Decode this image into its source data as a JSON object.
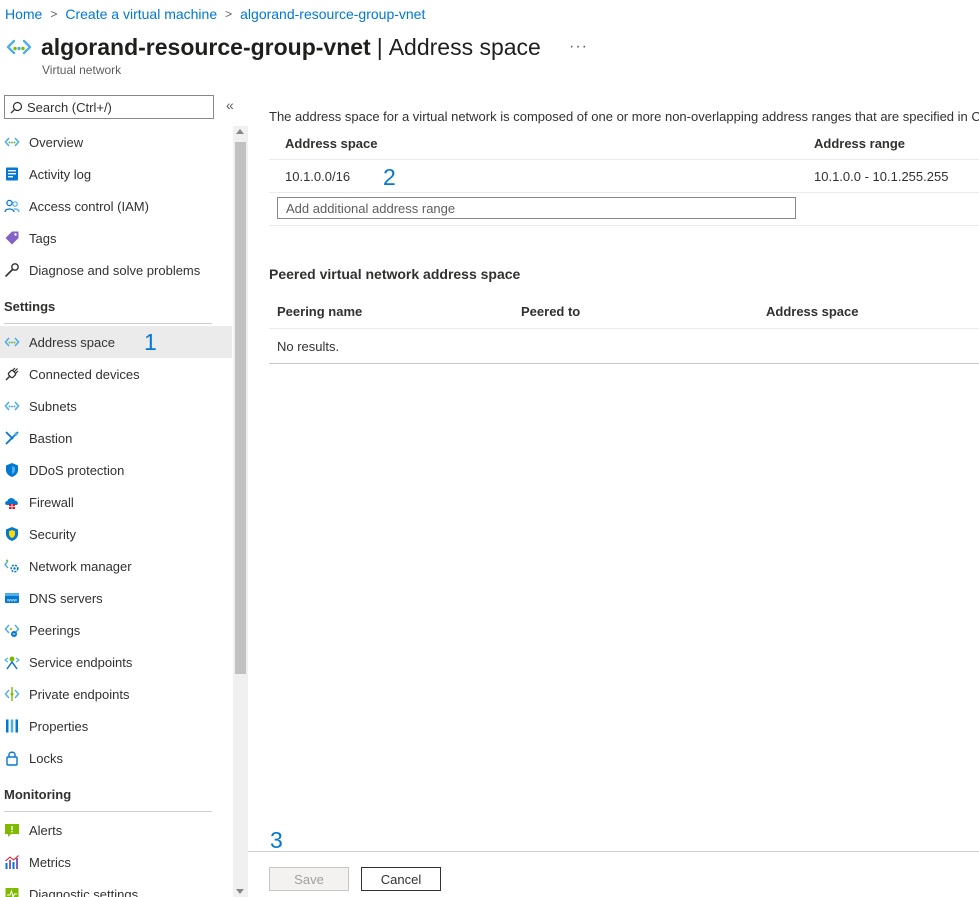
{
  "breadcrumb": [
    {
      "label": "Home"
    },
    {
      "label": "Create a virtual machine"
    },
    {
      "label": "algorand-resource-group-vnet"
    }
  ],
  "header": {
    "resource_name": "algorand-resource-group-vnet",
    "separator": "|",
    "page_name": "Address space",
    "more": "···",
    "subtitle": "Virtual network"
  },
  "search": {
    "placeholder": "Search (Ctrl+/)"
  },
  "collapse": "«",
  "nav": {
    "top": [
      {
        "label": "Overview",
        "icon": "vnet-icon"
      },
      {
        "label": "Activity log",
        "icon": "activity-log-icon"
      },
      {
        "label": "Access control (IAM)",
        "icon": "people-icon"
      },
      {
        "label": "Tags",
        "icon": "tag-icon"
      },
      {
        "label": "Diagnose and solve problems",
        "icon": "wrench-icon"
      }
    ],
    "settings_title": "Settings",
    "settings": [
      {
        "label": "Address space",
        "icon": "vnet-icon",
        "active": true
      },
      {
        "label": "Connected devices",
        "icon": "plug-icon"
      },
      {
        "label": "Subnets",
        "icon": "vnet-icon"
      },
      {
        "label": "Bastion",
        "icon": "bastion-icon"
      },
      {
        "label": "DDoS protection",
        "icon": "shield-icon"
      },
      {
        "label": "Firewall",
        "icon": "firewall-icon"
      },
      {
        "label": "Security",
        "icon": "security-shield-icon"
      },
      {
        "label": "Network manager",
        "icon": "network-manager-icon"
      },
      {
        "label": "DNS servers",
        "icon": "dns-icon"
      },
      {
        "label": "Peerings",
        "icon": "peerings-icon"
      },
      {
        "label": "Service endpoints",
        "icon": "service-endpoints-icon"
      },
      {
        "label": "Private endpoints",
        "icon": "private-endpoints-icon"
      },
      {
        "label": "Properties",
        "icon": "properties-icon"
      },
      {
        "label": "Locks",
        "icon": "lock-icon"
      }
    ],
    "monitoring_title": "Monitoring",
    "monitoring": [
      {
        "label": "Alerts",
        "icon": "alerts-icon"
      },
      {
        "label": "Metrics",
        "icon": "metrics-icon"
      },
      {
        "label": "Diagnostic settings",
        "icon": "diagnostic-icon"
      }
    ]
  },
  "annotations": {
    "one": "1",
    "two": "2",
    "three": "3"
  },
  "main": {
    "description": "The address space for a virtual network is composed of one or more non-overlapping address ranges that are specified in CI",
    "address_table": {
      "headers": [
        "Address space",
        "Address range"
      ],
      "rows": [
        {
          "space": "10.1.0.0/16",
          "range": "10.1.0.0 - 10.1.255.255"
        }
      ]
    },
    "add_range_placeholder": "Add additional address range",
    "peered_title": "Peered virtual network address space",
    "peered_table": {
      "headers": [
        "Peering name",
        "Peered to",
        "Address space"
      ],
      "empty": "No results."
    },
    "save_label": "Save",
    "cancel_label": "Cancel"
  },
  "colors": {
    "accent": "#0078d4",
    "active_bg": "#ebebeb"
  }
}
